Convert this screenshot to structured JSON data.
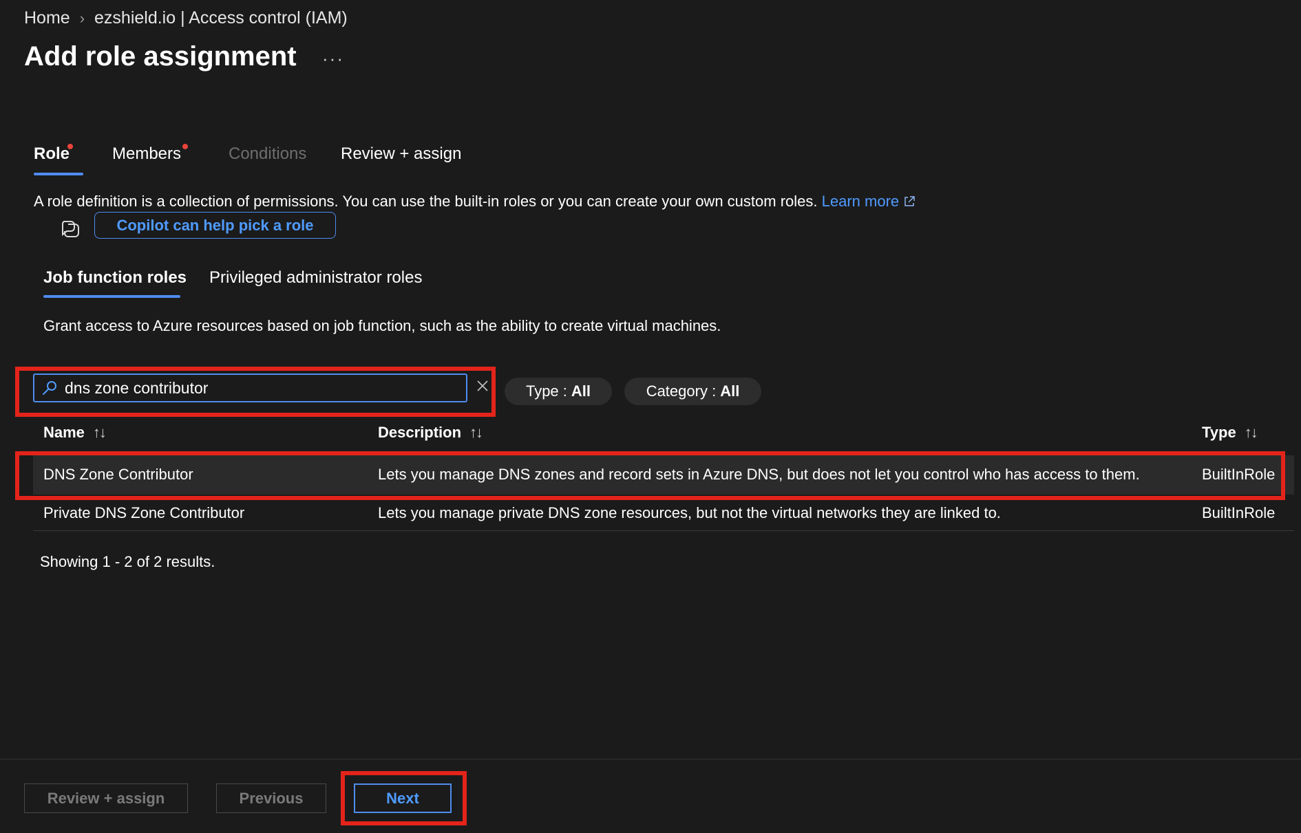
{
  "breadcrumb": {
    "home": "Home",
    "separator": "›",
    "current": "ezshield.io | Access control (IAM)"
  },
  "page": {
    "title": "Add role assignment",
    "more": "···"
  },
  "tabs": [
    {
      "label": "Role"
    },
    {
      "label": "Members"
    },
    {
      "label": "Conditions"
    },
    {
      "label": "Review + assign"
    }
  ],
  "description": {
    "text": "A role definition is a collection of permissions. You can use the built-in roles or you can create your own custom roles.",
    "link": "Learn more"
  },
  "copilot": {
    "label": "Copilot can help pick a role"
  },
  "subtabs": [
    {
      "label": "Job function roles"
    },
    {
      "label": "Privileged administrator roles"
    }
  ],
  "grant_text": "Grant access to Azure resources based on job function, such as the ability to create virtual machines.",
  "search": {
    "value": "dns zone contributor"
  },
  "filters": {
    "type": {
      "label": "Type :",
      "value": "All"
    },
    "category": {
      "label": "Category :",
      "value": "All"
    }
  },
  "table": {
    "columns": {
      "name": "Name",
      "description": "Description",
      "type": "Type"
    },
    "sort_glyph": "↑↓",
    "rows": [
      {
        "name": "DNS Zone Contributor",
        "description": "Lets you manage DNS zones and record sets in Azure DNS, but does not let you control who has access to them.",
        "type": "BuiltInRole"
      },
      {
        "name": "Private DNS Zone Contributor",
        "description": "Lets you manage private DNS zone resources, but not the virtual networks they are linked to.",
        "type": "BuiltInRole"
      }
    ]
  },
  "results_text": "Showing 1 - 2 of 2 results.",
  "footer": {
    "review": "Review + assign",
    "previous": "Previous",
    "next": "Next"
  },
  "colors": {
    "accent": "#4f8cf0",
    "link": "#4f9bff",
    "highlight": "#e3241b",
    "required_dot": "#e8443a"
  }
}
